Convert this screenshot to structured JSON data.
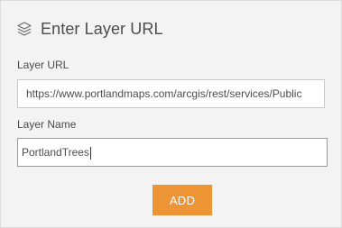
{
  "dialog": {
    "title": "Enter Layer URL",
    "icon": "layers-icon"
  },
  "fields": {
    "url": {
      "label": "Layer URL",
      "value": "https://www.portlandmaps.com/arcgis/rest/services/Public"
    },
    "name": {
      "label": "Layer Name",
      "value": "PortlandTrees"
    }
  },
  "actions": {
    "add_label": "ADD",
    "add_color": "#ed9535"
  }
}
